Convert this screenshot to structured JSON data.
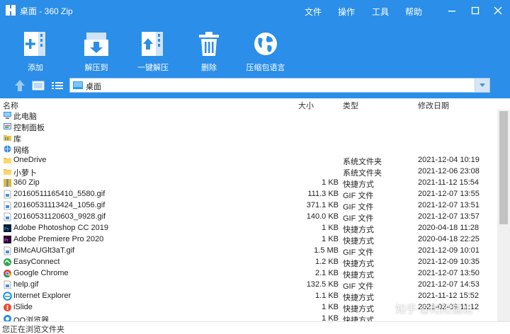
{
  "window": {
    "title": "桌面 - 360 Zip",
    "menu": [
      "文件",
      "操作",
      "工具",
      "帮助"
    ]
  },
  "toolbar": [
    {
      "label": "添加",
      "icon": "add-archive-icon"
    },
    {
      "label": "解压到",
      "icon": "extract-to-icon"
    },
    {
      "label": "一键解压",
      "icon": "one-click-extract-icon"
    },
    {
      "label": "删除",
      "icon": "trash-icon"
    },
    {
      "label": "压缩包语言",
      "icon": "globe-icon"
    }
  ],
  "path_bar": {
    "value": "桌面"
  },
  "columns": {
    "name": "名称",
    "size": "大小",
    "type": "类型",
    "modified": "修改日期"
  },
  "files": [
    {
      "name": "此电脑",
      "size": "",
      "type": "",
      "date": "",
      "icon": "computer-icon"
    },
    {
      "name": "控制面板",
      "size": "",
      "type": "",
      "date": "",
      "icon": "control-panel-icon"
    },
    {
      "name": "库",
      "size": "",
      "type": "",
      "date": "",
      "icon": "library-icon"
    },
    {
      "name": "网络",
      "size": "",
      "type": "",
      "date": "",
      "icon": "network-icon"
    },
    {
      "name": "OneDrive",
      "size": "",
      "type": "系统文件夹",
      "date": "2021-12-04 10:19",
      "icon": "folder-icon"
    },
    {
      "name": "小萝卜",
      "size": "",
      "type": "系统文件夹",
      "date": "2021-12-06 23:08",
      "icon": "folder-icon"
    },
    {
      "name": "360 Zip",
      "size": "1 KB",
      "type": "快捷方式",
      "date": "2021-11-12 15:54",
      "icon": "zip-app-icon"
    },
    {
      "name": "20160511165410_5580.gif",
      "size": "111.3 KB",
      "type": "GIF 文件",
      "date": "2021-12-07 13:55",
      "icon": "gif-file-icon"
    },
    {
      "name": "20160531113424_1056.gif",
      "size": "371.1 KB",
      "type": "GIF 文件",
      "date": "2021-12-07 13:51",
      "icon": "gif-file-icon"
    },
    {
      "name": "20160531120603_9928.gif",
      "size": "140.0 KB",
      "type": "GIF 文件",
      "date": "2021-12-07 13:57",
      "icon": "gif-file-icon"
    },
    {
      "name": "Adobe Photoshop CC 2019",
      "size": "1 KB",
      "type": "快捷方式",
      "date": "2020-04-18 11:28",
      "icon": "photoshop-icon"
    },
    {
      "name": "Adobe Premiere Pro 2020",
      "size": "1 KB",
      "type": "快捷方式",
      "date": "2020-04-18 22:25",
      "icon": "premiere-icon"
    },
    {
      "name": "BiMcAUGlt3aT.gif",
      "size": "1.5 MB",
      "type": "GIF 文件",
      "date": "2021-12-09 10:01",
      "icon": "gif-file-icon"
    },
    {
      "name": "EasyConnect",
      "size": "1.2 KB",
      "type": "快捷方式",
      "date": "2021-12-09 10:35",
      "icon": "easyconnect-icon"
    },
    {
      "name": "Google Chrome",
      "size": "2.1 KB",
      "type": "快捷方式",
      "date": "2021-12-07 13:50",
      "icon": "chrome-icon"
    },
    {
      "name": "help.gif",
      "size": "132.5 KB",
      "type": "GIF 文件",
      "date": "2021-12-07 14:53",
      "icon": "gif-file-icon"
    },
    {
      "name": "Internet Explorer",
      "size": "1.1 KB",
      "type": "快捷方式",
      "date": "2021-11-12 15:52",
      "icon": "ie-icon"
    },
    {
      "name": "iSlide",
      "size": "1 KB",
      "type": "快捷方式",
      "date": "2021-02-09 11:12",
      "icon": "islide-icon"
    },
    {
      "name": "QQ浏览器",
      "size": "1 KB",
      "type": "快捷方式",
      "date": "",
      "icon": "qq-browser-icon"
    }
  ],
  "status": {
    "text": "您正在浏览文件夹"
  },
  "watermark": "知乎 @阳阳猫姐",
  "colors": {
    "accent": "#2b8ee8",
    "path_border": "#9ec6ee"
  }
}
